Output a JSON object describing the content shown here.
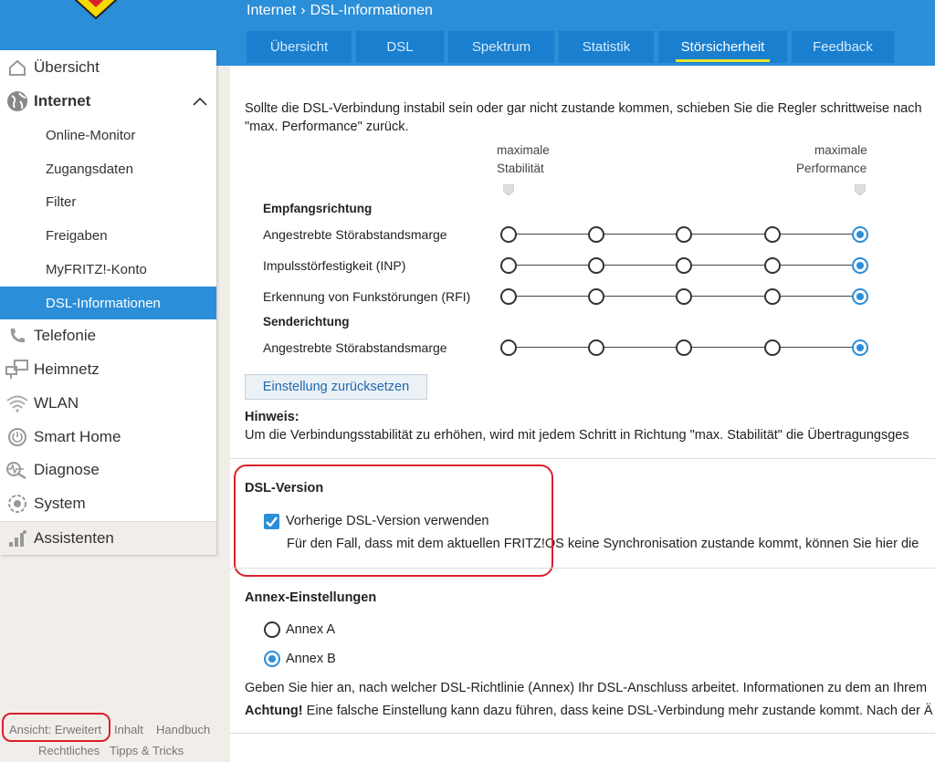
{
  "header": {
    "breadcrumb_parent": "Internet",
    "breadcrumb_sep": "›",
    "breadcrumb_current": "DSL-Informationen",
    "tabs": [
      {
        "label": "Übersicht"
      },
      {
        "label": "DSL"
      },
      {
        "label": "Spektrum"
      },
      {
        "label": "Statistik"
      },
      {
        "label": "Störsicherheit",
        "active": true
      },
      {
        "label": "Feedback"
      }
    ]
  },
  "sidebar": {
    "items": [
      {
        "label": "Übersicht",
        "icon": "home-icon"
      },
      {
        "label": "Internet",
        "icon": "globe-icon",
        "expanded": true
      },
      {
        "label": "Online-Monitor"
      },
      {
        "label": "Zugangsdaten"
      },
      {
        "label": "Filter"
      },
      {
        "label": "Freigaben"
      },
      {
        "label": "MyFRITZ!-Konto"
      },
      {
        "label": "DSL-Informationen",
        "active": true
      },
      {
        "label": "Telefonie",
        "icon": "phone-icon"
      },
      {
        "label": "Heimnetz",
        "icon": "network-icon"
      },
      {
        "label": "WLAN",
        "icon": "wifi-icon"
      },
      {
        "label": "Smart Home",
        "icon": "power-icon"
      },
      {
        "label": "Diagnose",
        "icon": "diagnose-icon"
      },
      {
        "label": "System",
        "icon": "system-icon"
      },
      {
        "label": "Assistenten",
        "icon": "assistant-icon"
      }
    ],
    "accent": "#2b8ed8"
  },
  "footer": {
    "view": "Ansicht: Erweitert",
    "content": "Inhalt",
    "manual": "Handbuch",
    "legal": "Rechtliches",
    "tips": "Tipps & Tricks"
  },
  "main": {
    "intro_line1": "Sollte die DSL-Verbindung instabil sein oder gar nicht zustande kommen, schieben Sie die Regler schrittweise nach",
    "intro_line2": "\"max. Performance\" zurück.",
    "scale_left_1": "maximale",
    "scale_left_2": "Stabilität",
    "scale_right_1": "maximale",
    "scale_right_2": "Performance",
    "receive_heading": "Empfangsrichtung",
    "send_heading": "Senderichtung",
    "sliders": [
      {
        "label": "Angestrebte Störabstandsmarge",
        "selected_step": 5,
        "steps": 5
      },
      {
        "label": "Impulsstörfestigkeit (INP)",
        "selected_step": 5,
        "steps": 5
      },
      {
        "label": "Erkennung von Funkstörungen (RFI)",
        "selected_step": 5,
        "steps": 5
      },
      {
        "label": "Angestrebte Störabstandsmarge",
        "selected_step": 5,
        "steps": 5
      }
    ],
    "reset_button": "Einstellung zurücksetzen",
    "hint_label": "Hinweis:",
    "hint_text": "Um die Verbindungsstabilität zu erhöhen, wird mit jedem Schritt in Richtung \"max. Stabilität\" die Übertragungsges",
    "dsl_version_heading": "DSL-Version",
    "dsl_version_checkbox": "Vorherige DSL-Version verwenden",
    "dsl_version_checked": true,
    "dsl_version_text": "Für den Fall, dass mit dem aktuellen FRITZ!OS keine Synchronisation zustande kommt, können Sie hier die",
    "annex_heading": "Annex-Einstellungen",
    "annex_options": [
      {
        "label": "Annex A",
        "selected": false
      },
      {
        "label": "Annex B",
        "selected": true
      }
    ],
    "annex_text": "Geben Sie hier an, nach welcher DSL-Richtlinie (Annex) Ihr DSL-Anschluss arbeitet. Informationen zu dem an Ihrem",
    "warning_label": "Achtung!",
    "warning_text": " Eine falsche Einstellung kann dazu führen, dass keine DSL-Verbindung mehr zustande kommt. Nach der Ä"
  }
}
